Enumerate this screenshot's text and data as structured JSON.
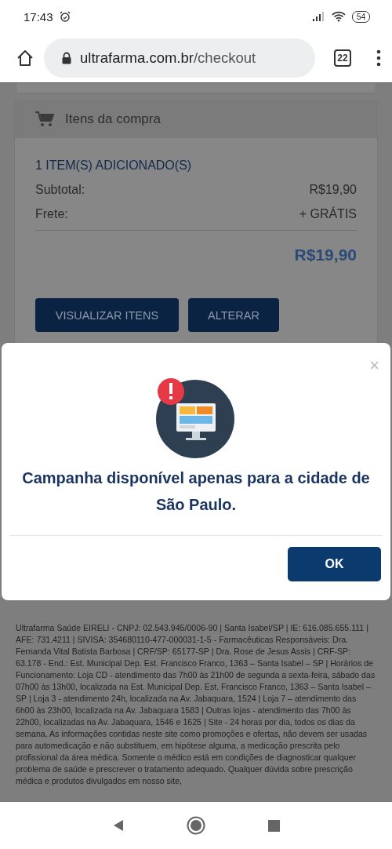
{
  "status_bar": {
    "time": "17:43",
    "battery": "54"
  },
  "browser": {
    "url_host": "ultrafarma.com.br",
    "url_path": "/checkout",
    "tab_count": "22"
  },
  "cart_card": {
    "title": "Itens da compra",
    "items_added": "1 ITEM(S) ADICIONADO(S)",
    "lines": [
      {
        "label": "Subtotal:",
        "value": "R$19,90"
      },
      {
        "label": "Frete:",
        "value": "+ GRÁTIS"
      }
    ],
    "total": "R$19,90",
    "buttons": [
      "VISUALIZAR ITENS",
      "ALTERAR"
    ]
  },
  "footer_text": "Ultrafarma Saúde EIRELI - CNPJ: 02.543.945/0006-90 | Santa Isabel/SP | IE: 616.085.655.111 | AFE: 731.4211 | SIVISA: 354680110-477-000031-1-5 - Farmacêuticas Responsáveis: Dra. Fernanda Vital Batista Barbosa | CRF/SP: 65177-SP | Dra. Rose de Jesus Assis | CRF-SP: 63.178 - End.: Est. Municipal Dep. Est. Francisco Franco, 1363 – Santa Isabel – SP | Horários de Funcionamento: Loja CD - atendimento das 7h00 às 21h00 de segunda a sexta-feira, sábado das 07h00 às 13h00, localizada na Est. Municipal Dep. Est. Francisco Franco, 1363 – Santa Isabel – SP | Loja 3 - atendimento 24h, localizada na Av. Jabaquara, 1524 | Loja 7 – atendimento das 6h00 às 23h00, localizada na Av. Jabaquara 1583 | Outras lojas - atendimento das 7h00 às 22h00, localizadas na Av. Jabaquara, 1546 e 1625 | Site - 24 horas por dia, todos os dias da semana. As informações contidas neste site como promoções e ofertas, não devem ser usadas para automedicação e não substituem, em hipótese alguma, a medicação prescrita pelo profissional da área médica. Somente o médico está em condições de diagnosticar qualquer problema de saúde e prescrever o tratamento adequado. Qualquer dúvida sobre prescrição médica e produtos divulgados em nosso site,",
  "modal": {
    "close": "×",
    "message": "Campanha disponível apenas para a cidade de São Paulo.",
    "ok_button": "OK"
  }
}
